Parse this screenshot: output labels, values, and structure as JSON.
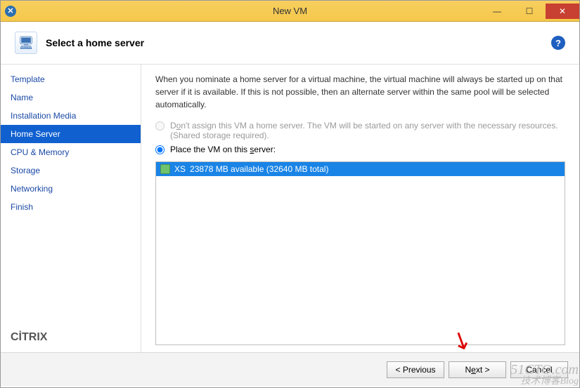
{
  "window": {
    "title": "New VM",
    "sys_icon_glyph": "✕"
  },
  "header": {
    "title": "Select a home server"
  },
  "sidebar": {
    "items": [
      {
        "label": "Template",
        "active": false
      },
      {
        "label": "Name",
        "active": false
      },
      {
        "label": "Installation Media",
        "active": false
      },
      {
        "label": "Home Server",
        "active": true
      },
      {
        "label": "CPU & Memory",
        "active": false
      },
      {
        "label": "Storage",
        "active": false
      },
      {
        "label": "Networking",
        "active": false
      },
      {
        "label": "Finish",
        "active": false
      }
    ],
    "brand": "CİTRIX"
  },
  "main": {
    "description": "When you nominate a home server for a virtual machine, the virtual machine will always be started up on that server if it is available. If this is not possible, then an alternate server within the same pool will be selected automatically.",
    "option_none": {
      "label_pre": "D",
      "label_underline": "o",
      "label_post": "n't assign this VM a home server. The VM will be started on any server with the necessary resources.",
      "subtext": "(Shared storage required).",
      "disabled": true,
      "selected": false
    },
    "option_place": {
      "label_pre": "Place the VM on this ",
      "label_underline": "s",
      "label_post": "erver:",
      "selected": true
    },
    "servers": [
      {
        "name": "XS",
        "detail": "23878 MB available (32640 MB total)",
        "selected": true
      }
    ]
  },
  "footer": {
    "previous": "< Previous",
    "next_pre": "N",
    "next_u": "e",
    "next_post": "xt >",
    "cancel": "Cancel"
  },
  "watermark": {
    "line1": "51CTO.com",
    "line2": "技术博客Blog"
  }
}
